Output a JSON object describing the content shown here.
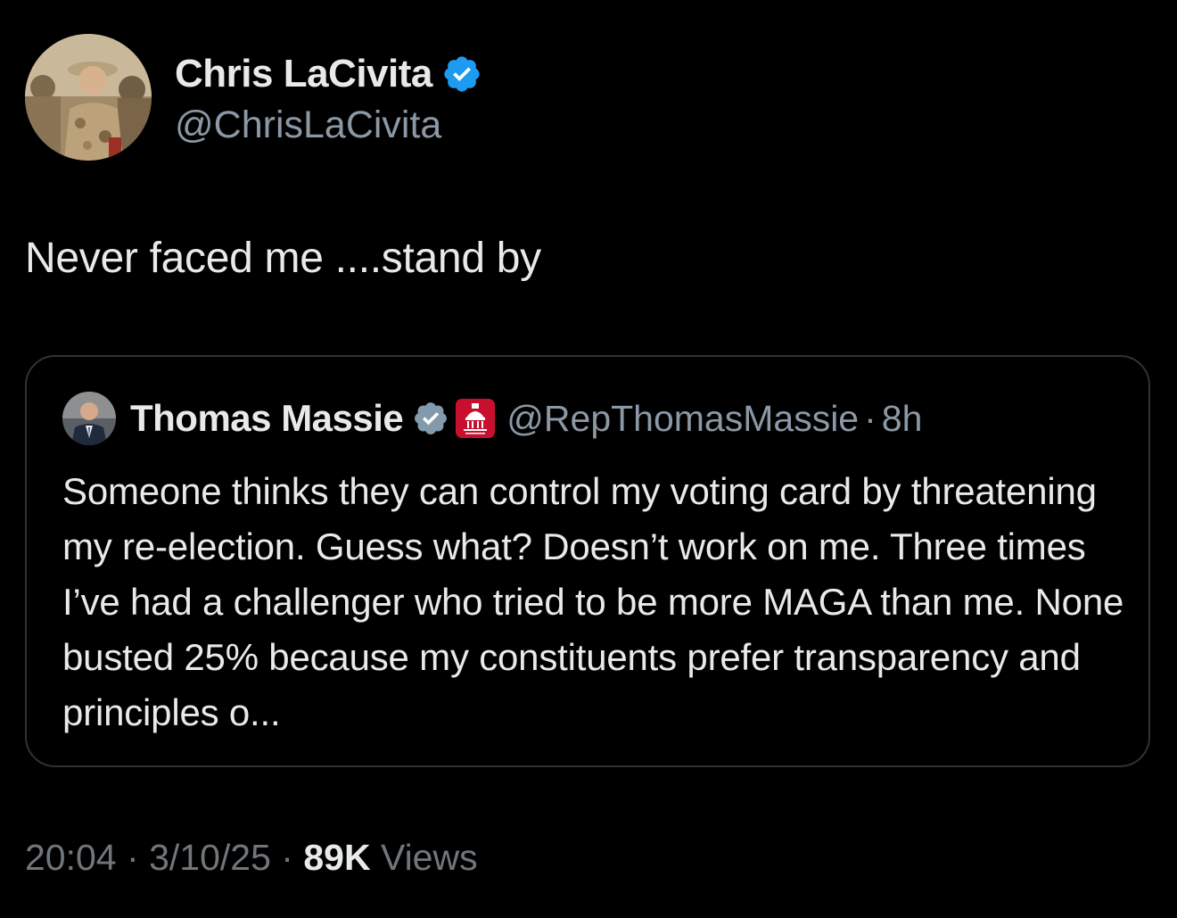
{
  "tweet": {
    "author": {
      "display_name": "Chris LaCivita",
      "handle": "@ChrisLaCivita",
      "verified": true,
      "avatar_icon": "military-profile-avatar"
    },
    "text": "Never faced me ....stand by",
    "quoted": {
      "author": {
        "display_name": "Thomas Massie",
        "handle": "@RepThomasMassie",
        "verified": true,
        "affiliation_icon": "house-gop-badge-icon",
        "avatar_icon": "politician-avatar"
      },
      "separator": "·",
      "time": "8h",
      "text": "Someone thinks they can control my voting card by threatening my re-election. Guess what? Doesn’t work on me. Three times I’ve had a challenger who tried to be more MAGA than me. None busted 25% because my constituents prefer transparency and principles o..."
    },
    "meta": {
      "time": "20:04",
      "separator": "·",
      "date": "3/10/25",
      "views_count": "89K",
      "views_label": "Views"
    }
  },
  "colors": {
    "background": "#000000",
    "primary_text": "#e7e9ea",
    "secondary_text": "#71767b",
    "border": "#2f3336",
    "verified_blue": "#1d9bf0",
    "verified_gray": "#829aab",
    "gop_red": "#c8102e"
  }
}
